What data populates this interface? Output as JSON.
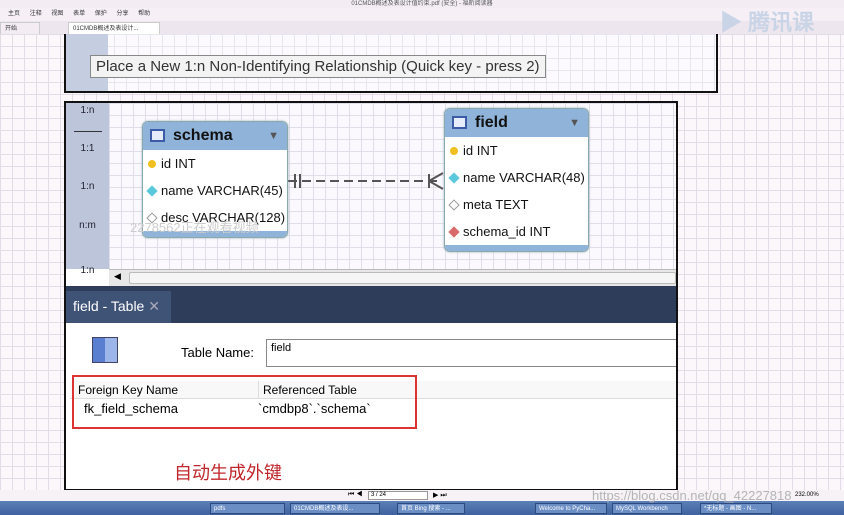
{
  "window": {
    "title": "01CMDB概述及表设计值约束.pdf (安全) - 福昕阅读器"
  },
  "menu": [
    "主页",
    "注释",
    "视图",
    "表单",
    "保护",
    "分享",
    "帮助"
  ],
  "tabs": [
    {
      "label": "开始"
    },
    {
      "label": "01CMDB概述及表设计..."
    }
  ],
  "logo": {
    "text": "腾讯课"
  },
  "tooltip": "Place a New 1:n Non-Identifying Relationship (Quick key - press 2)",
  "toolbar": {
    "labels": [
      "1:n",
      "1:1",
      "1:n",
      "n:m",
      "1:n"
    ]
  },
  "entities": [
    {
      "name": "schema",
      "columns": [
        {
          "text": "id INT",
          "kind": "pk"
        },
        {
          "text": "name VARCHAR(45)",
          "kind": "notnull"
        },
        {
          "text": "desc VARCHAR(128)",
          "kind": "nullable"
        }
      ]
    },
    {
      "name": "field",
      "columns": [
        {
          "text": "id INT",
          "kind": "pk"
        },
        {
          "text": "name VARCHAR(48)",
          "kind": "notnull"
        },
        {
          "text": "meta TEXT",
          "kind": "nullable"
        },
        {
          "text": "schema_id INT",
          "kind": "fk"
        }
      ]
    }
  ],
  "editor": {
    "tab_label": "field - Table",
    "table_name_label": "Table Name:",
    "table_name_value": "field",
    "fk_columns": [
      "Foreign Key Name",
      "Referenced Table"
    ],
    "fk_rows": [
      [
        "fk_field_schema",
        "`cmdbp8`.`schema`"
      ]
    ]
  },
  "annotation": "自动生成外键",
  "overlay": {
    "viewer_notice": "2278562正在观看视频",
    "url_watermark": "https://blog.csdn.net/qq_42227818"
  },
  "pdfnav": {
    "page": "3 / 24",
    "zoom": "232.00%"
  },
  "taskbar": [
    "pdfs",
    "01CMDB概述及表设...",
    "首页 Bing 搜索 - ...",
    "Welcome to PyCha...",
    "MySQL Workbench",
    "*无标题 - 画图 - N..."
  ],
  "colors": {
    "entity_header": "#8fb3d9",
    "annotation": "#c0262b",
    "highlight_box": "#dd3333",
    "dark_bar": "#2e3d5a"
  }
}
